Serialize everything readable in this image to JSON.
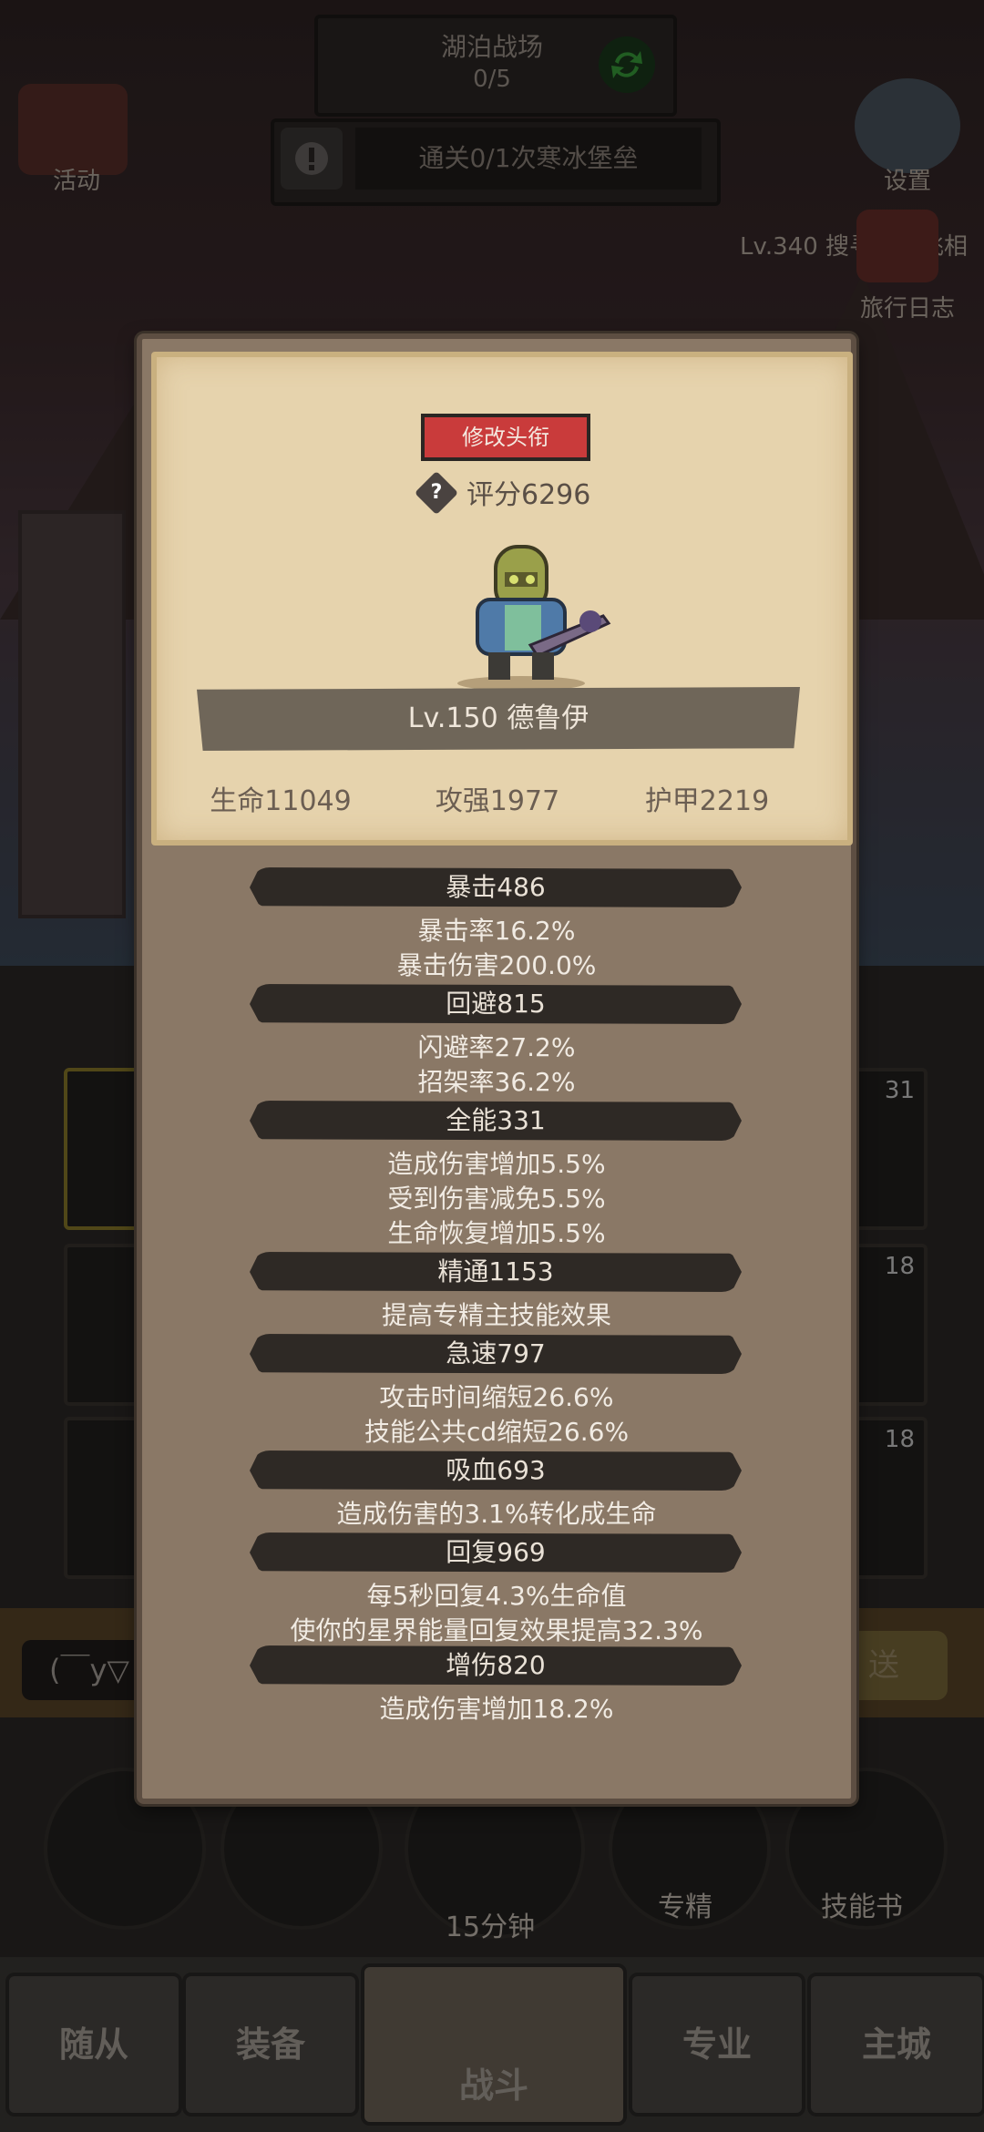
{
  "hud": {
    "battlefield_title": "湖泊战场",
    "battlefield_count": "0/5",
    "quest_text": "通关0/1次寒冰堡垒",
    "activity_label": "活动",
    "settings_label": "设置",
    "journal_label": "旅行日志",
    "player_info": "Lv.340 搜寻者小飞相"
  },
  "panel": {
    "edit_title_label": "修改头衔",
    "score_icon": "question-icon",
    "score_icon_glyph": "?",
    "score_text": "评分6296",
    "hero_name": "Lv.150 德鲁伊",
    "base_stats": [
      "生命11049",
      "攻强1977",
      "护甲2219"
    ],
    "sections": [
      {
        "title": "暴击486",
        "lines": [
          "暴击率16.2%",
          "暴击伤害200.0%"
        ]
      },
      {
        "title": "回避815",
        "lines": [
          "闪避率27.2%",
          "招架率36.2%"
        ]
      },
      {
        "title": "全能331",
        "lines": [
          "造成伤害增加5.5%",
          "受到伤害减免5.5%",
          "生命恢复增加5.5%"
        ]
      },
      {
        "title": "精通1153",
        "lines": [
          "提高专精主技能效果"
        ]
      },
      {
        "title": "急速797",
        "lines": [
          "攻击时间缩短26.6%",
          "技能公共cd缩短26.6%"
        ]
      },
      {
        "title": "吸血693",
        "lines": [
          "造成伤害的3.1%转化成生命"
        ]
      },
      {
        "title": "回复969",
        "lines": [
          "每5秒回复4.3%生命值",
          "使你的星界能量回复效果提高32.3%"
        ]
      },
      {
        "title": "增伤820",
        "lines": [
          "造成伤害增加18.2%"
        ]
      }
    ]
  },
  "background": {
    "slot_badges": [
      "31",
      "18",
      "18"
    ],
    "chat_placeholder": "(￣y▽",
    "send_label": "送",
    "timer_label": "15分钟",
    "spec_label": "专精",
    "skillbook_label": "技能书",
    "nav": [
      "随从",
      "装备",
      "战斗",
      "专业",
      "主城"
    ]
  }
}
